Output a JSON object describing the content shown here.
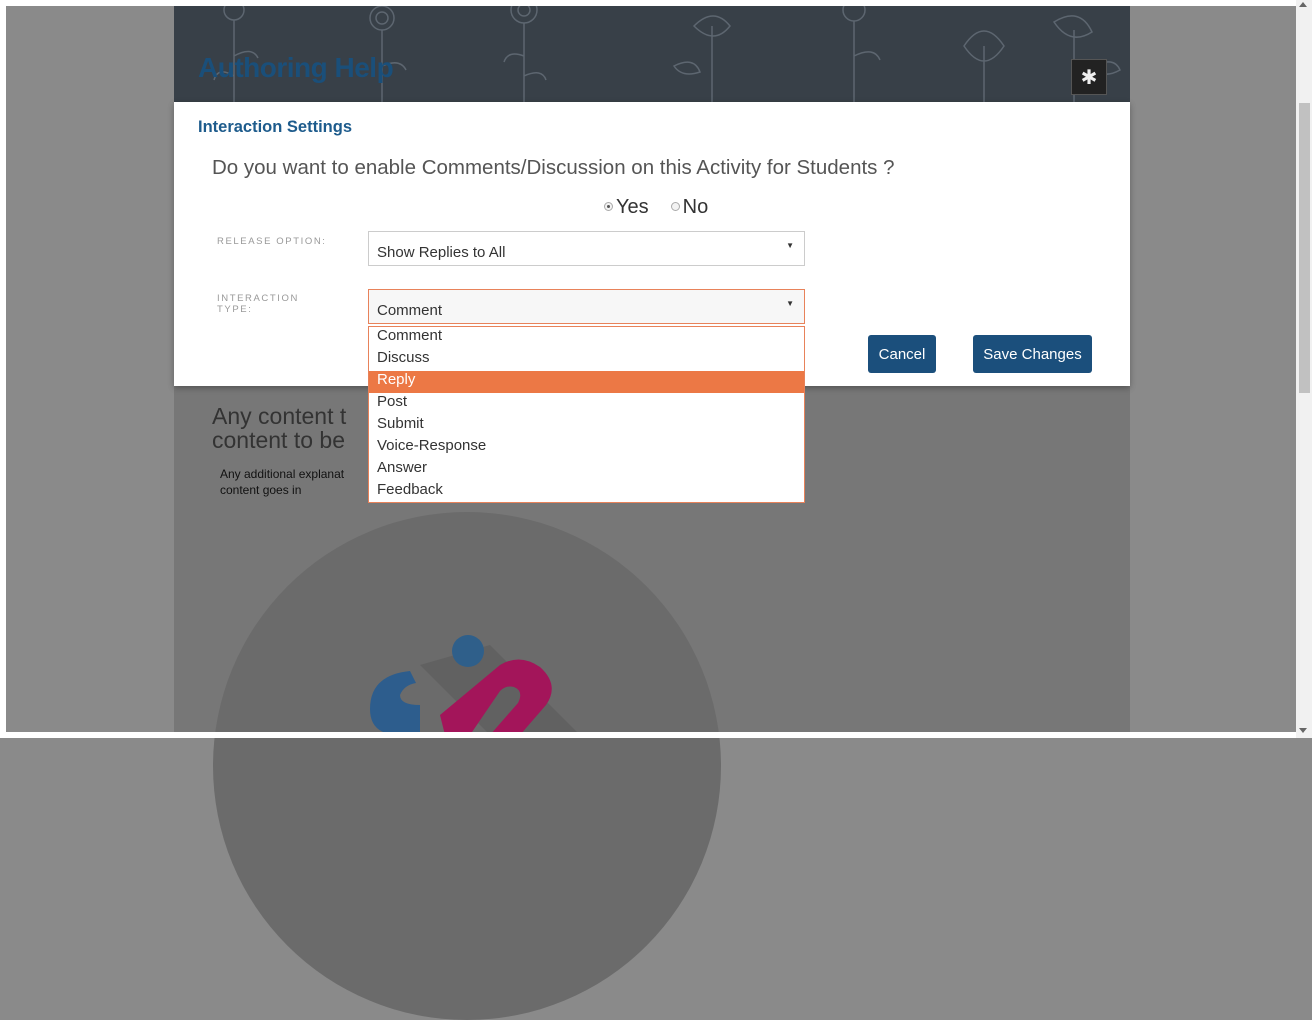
{
  "banner": {
    "title": "Authoring Help",
    "settings_icon": "gear-icon"
  },
  "background_content": {
    "title": "Any content to be the content to be",
    "title_line1": "Any content t",
    "title_line2": "content to be",
    "subtitle_line1": "Any additional explanat",
    "subtitle_line2": "content goes in"
  },
  "modal": {
    "title": "Interaction Settings",
    "question": "Do you want to enable Comments/Discussion on this Activity for Students ?",
    "radio": {
      "yes_label": "Yes",
      "no_label": "No",
      "selected": "Yes"
    },
    "release_option": {
      "label": "RELEASE OPTION:",
      "value": "Show Replies to All"
    },
    "interaction_type": {
      "label_line1": "INTERACTION",
      "label_line2": "TYPE:",
      "value": "Comment",
      "options": [
        "Comment",
        "Discuss",
        "Reply",
        "Post",
        "Submit",
        "Voice-Response",
        "Answer",
        "Feedback"
      ],
      "highlighted": "Reply"
    },
    "cancel_label": "Cancel",
    "save_label": "Save Changes"
  },
  "colors": {
    "accent": "#1b4f7c",
    "highlight": "#ec7845",
    "title": "#1d5b8c"
  }
}
